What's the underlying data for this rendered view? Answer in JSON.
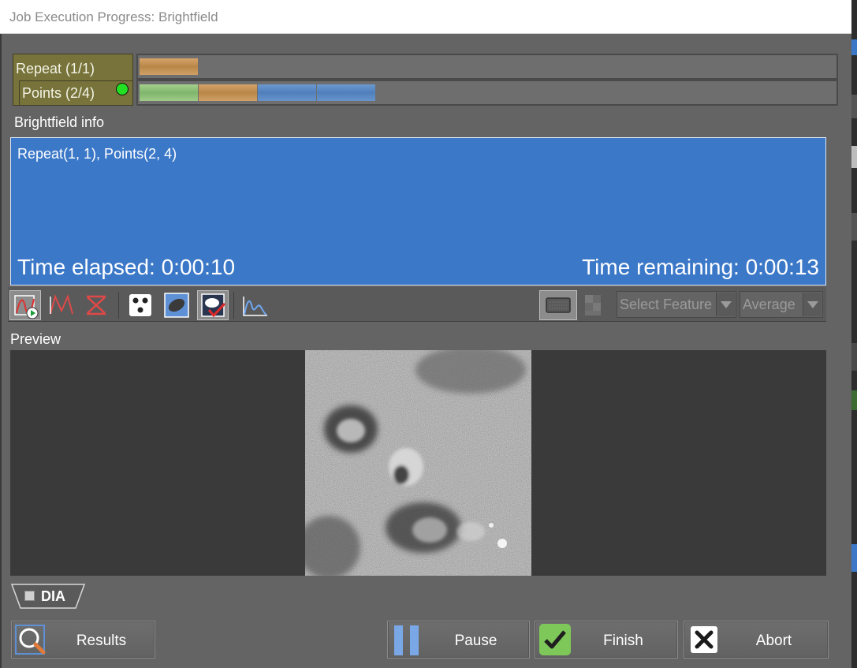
{
  "window": {
    "title": "Job Execution Progress: Brightfield"
  },
  "progress": {
    "repeat": {
      "label": "Repeat (1/1)"
    },
    "points": {
      "label": "Points (2/4)",
      "status_color": "#22e022"
    }
  },
  "info": {
    "label": "Brightfield info",
    "line": "Repeat(1, 1), Points(2, 4)",
    "elapsed": "Time elapsed: 0:00:10",
    "remaining": "Time remaining: 0:00:13",
    "background": "#3b78c8"
  },
  "toolbar": {
    "select_feature": "Select Feature",
    "average": "Average"
  },
  "preview": {
    "label": "Preview"
  },
  "tabs": [
    {
      "label": "DIA"
    }
  ],
  "buttons": {
    "results": "Results",
    "pause": "Pause",
    "finish": "Finish",
    "abort": "Abort"
  },
  "icons": {
    "toolbar": [
      "curve-play-icon",
      "curve-icon",
      "remove-curve-icon",
      "dots-icon",
      "roi-ellipse-icon",
      "roi-check-icon",
      "histogram-icon",
      "grid-icon",
      "pattern-icon"
    ],
    "buttons": [
      "magnifier-icon",
      "pause-icon",
      "check-icon",
      "close-icon"
    ]
  }
}
